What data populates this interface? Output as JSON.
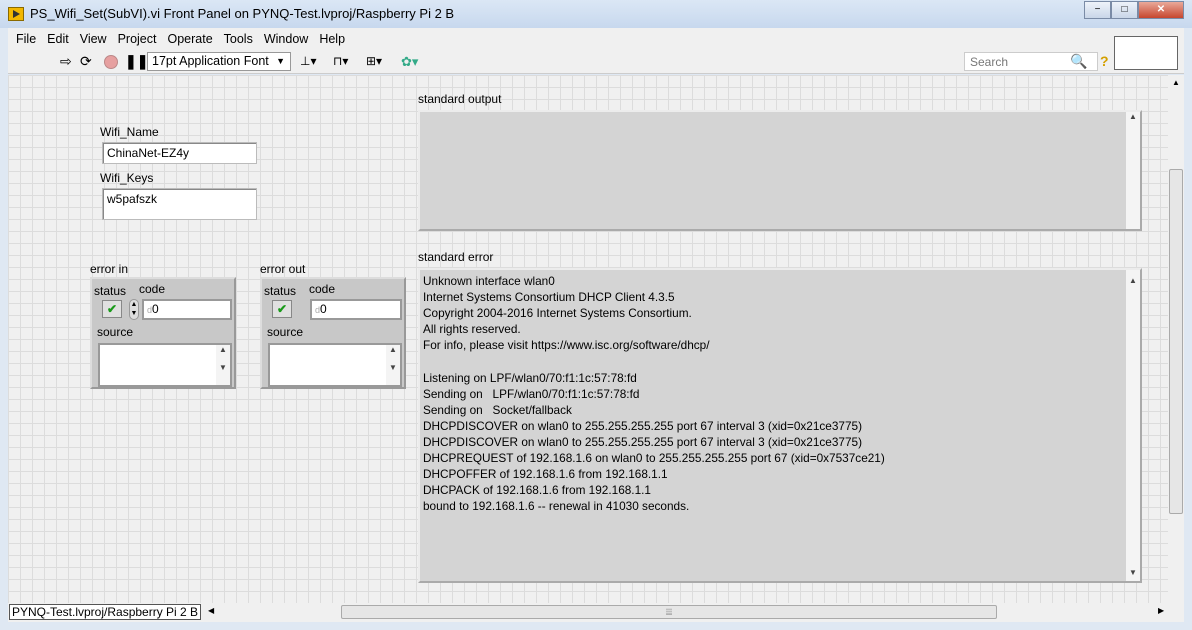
{
  "window": {
    "title": "PS_Wifi_Set(SubVI).vi Front Panel on PYNQ-Test.lvproj/Raspberry Pi 2 B",
    "minimize": "−",
    "maximize": "□",
    "close": "✕"
  },
  "menu": [
    "File",
    "Edit",
    "View",
    "Project",
    "Operate",
    "Tools",
    "Window",
    "Help"
  ],
  "toolbar": {
    "font": "17pt Application Font",
    "search_placeholder": "Search"
  },
  "controls": {
    "wifi_name_label": "Wifi_Name",
    "wifi_name_value": "ChinaNet-EZ4y",
    "wifi_keys_label": "Wifi_Keys",
    "wifi_keys_value": "w5pafszk",
    "error_in": {
      "label": "error in",
      "status_label": "status",
      "code_label": "code",
      "code_value": "0",
      "source_label": "source",
      "radix": "d"
    },
    "error_out": {
      "label": "error out",
      "status_label": "status",
      "code_label": "code",
      "code_value": "0",
      "source_label": "source",
      "radix": "d"
    },
    "standard_output_label": "standard output",
    "standard_error_label": "standard error",
    "standard_error_text": "Unknown interface wlan0\nInternet Systems Consortium DHCP Client 4.3.5\nCopyright 2004-2016 Internet Systems Consortium.\nAll rights reserved.\nFor info, please visit https://www.isc.org/software/dhcp/\n\nListening on LPF/wlan0/70:f1:1c:57:78:fd\nSending on   LPF/wlan0/70:f1:1c:57:78:fd\nSending on   Socket/fallback\nDHCPDISCOVER on wlan0 to 255.255.255.255 port 67 interval 3 (xid=0x21ce3775)\nDHCPDISCOVER on wlan0 to 255.255.255.255 port 67 interval 3 (xid=0x21ce3775)\nDHCPREQUEST of 192.168.1.6 on wlan0 to 255.255.255.255 port 67 (xid=0x7537ce21)\nDHCPOFFER of 192.168.1.6 from 192.168.1.1\nDHCPACK of 192.168.1.6 from 192.168.1.1\nbound to 192.168.1.6 -- renewal in 41030 seconds."
  },
  "statusbar": {
    "target": "PYNQ-Test.lvproj/Raspberry Pi 2 B"
  }
}
